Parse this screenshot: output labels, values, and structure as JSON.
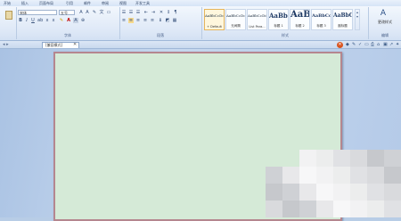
{
  "menu": [
    "开始",
    "插入",
    "页面布局",
    "引用",
    "邮件",
    "审阅",
    "视图",
    "开发工具"
  ],
  "font": {
    "name": "宋体",
    "size": "五号"
  },
  "groups": {
    "font": "字体",
    "paragraph": "段落",
    "styles": "样式",
    "edit": "编辑"
  },
  "styles": [
    {
      "preview": "AaBbCcDc",
      "name": "+ Default"
    },
    {
      "preview": "AaBbCcDc",
      "name": "无间隔"
    },
    {
      "preview": "AaBbCcDd",
      "name": "List Para..."
    },
    {
      "preview": "AaBbC",
      "name": "标题 1"
    },
    {
      "preview": "AaBl",
      "name": "标题 2"
    },
    {
      "preview": "AaBbCcI",
      "name": "标题 3"
    },
    {
      "preview": "AaBbCc",
      "name": "副标题"
    }
  ],
  "change_styles": "更改样式",
  "doc_tab": "[兼容模式]",
  "icons": [
    "paste-icon",
    "bold-icon",
    "italic-icon",
    "underline-icon",
    "font-color-icon",
    "align-left-icon",
    "align-center-icon",
    "align-right-icon",
    "bullets-icon",
    "change-styles-icon",
    "close-icon"
  ],
  "colors": {
    "page": "#d5ead7",
    "page_border": "#b5868f",
    "ribbon": "#dfe9f7",
    "workspace": "#b8cde6"
  }
}
